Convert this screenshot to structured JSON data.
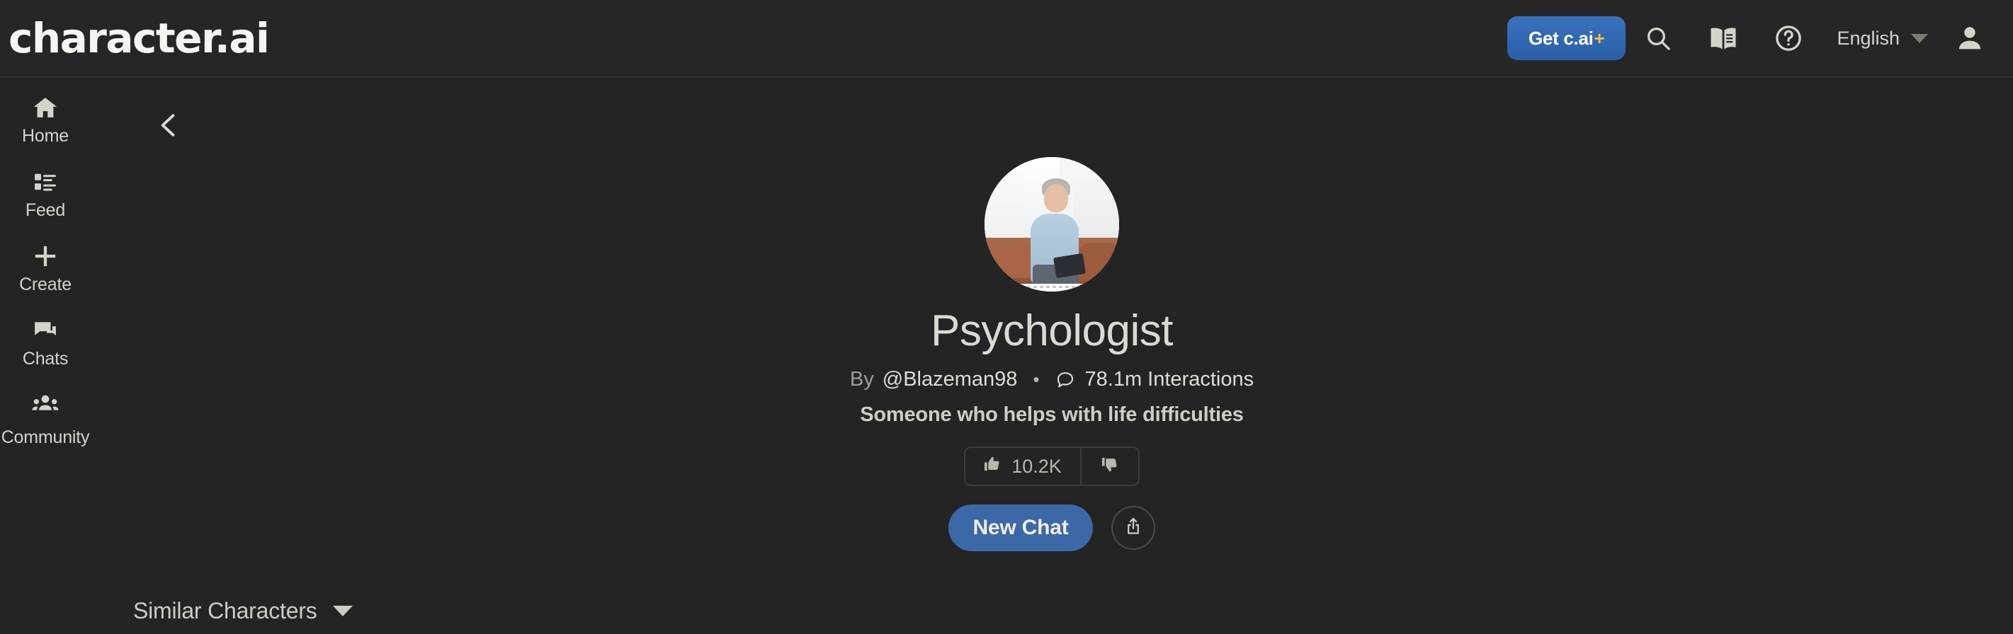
{
  "header": {
    "logo": "character.ai",
    "premium_button": {
      "label": "Get c.ai",
      "plus": "+"
    },
    "search_icon": "search-icon",
    "book_icon": "book-icon",
    "help_icon": "help-circle-icon",
    "language": "English",
    "account_icon": "account-icon",
    "accent_blue": "#2f6cb5",
    "accent_gold": "#f2c13c"
  },
  "sidebar": {
    "items": [
      {
        "label": "Home",
        "icon": "home-icon"
      },
      {
        "label": "Feed",
        "icon": "feed-list-icon"
      },
      {
        "label": "Create",
        "icon": "plus-icon"
      },
      {
        "label": "Chats",
        "icon": "chat-bubbles-icon"
      },
      {
        "label": "Community",
        "icon": "people-icon"
      }
    ]
  },
  "main": {
    "back_icon": "chevron-left-icon",
    "character": {
      "avatar_alt": "photo of a grey-haired woman in a light blue shirt holding a clipboard on a brown couch",
      "name": "Psychologist",
      "by_prefix": "By",
      "author": "@Blazeman98",
      "separator": "•",
      "interactions_icon": "speech-bubble-icon",
      "interactions": "78.1m Interactions",
      "tagline": "Someone who helps with life difficulties",
      "likes": {
        "icon": "thumbs-up-icon",
        "count": "10.2K"
      },
      "dislike_icon": "thumbs-down-icon",
      "new_chat_label": "New Chat",
      "share_icon": "share-icon",
      "new_chat_color": "#3c68a8"
    }
  },
  "footer": {
    "similar_characters_label": "Similar Characters",
    "caret_icon": "chevron-down-icon"
  }
}
